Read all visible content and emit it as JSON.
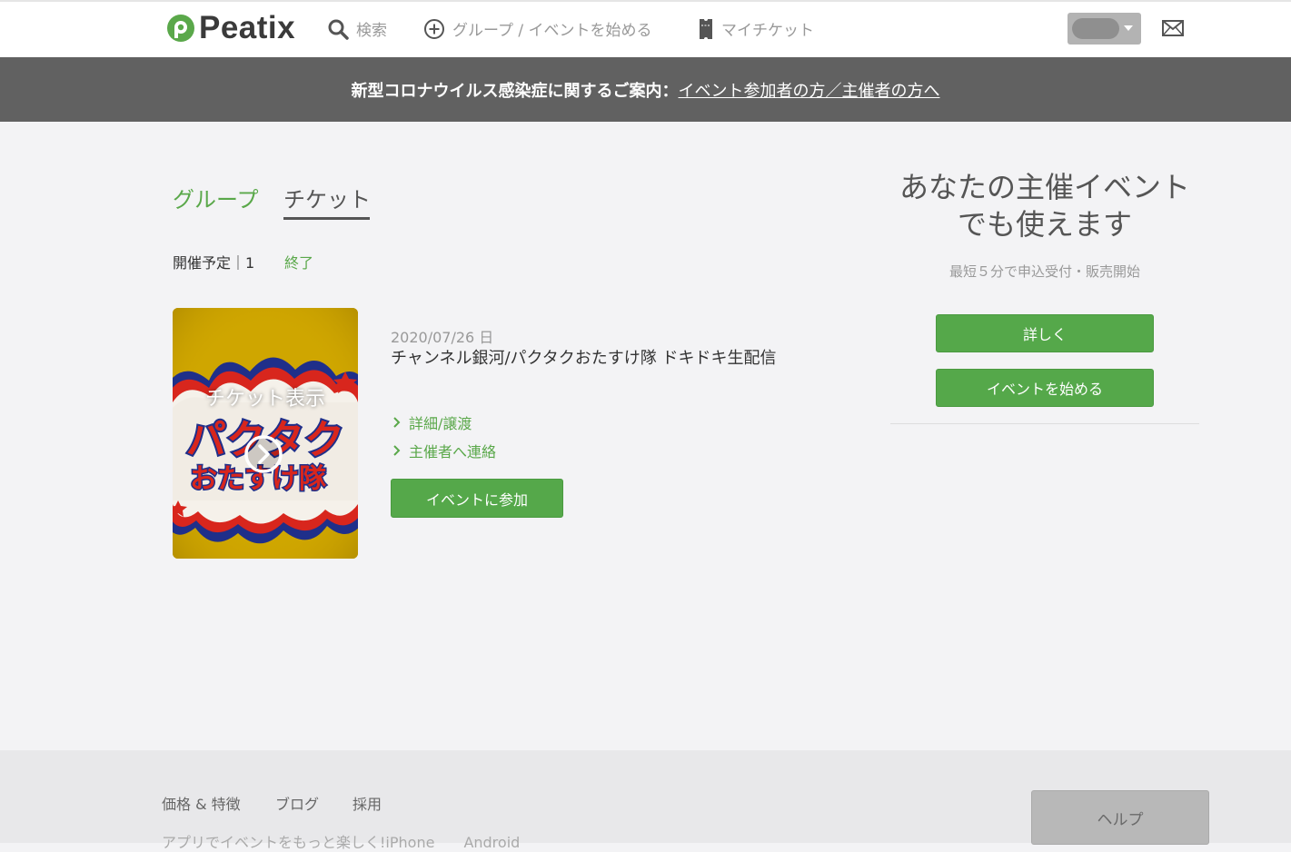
{
  "header": {
    "logo_text": "Peatix",
    "nav": {
      "search_label": "検索",
      "start_label": "グループ / イベントを始める",
      "ticket_label": "マイチケット"
    },
    "icons": {
      "search": "search-icon",
      "start": "plus-circle-icon",
      "ticket": "ticket-icon",
      "mail": "mail-icon",
      "account_caret": "caret-down-icon"
    }
  },
  "notice": {
    "prefix": "新型コロナウイルス感染症に関するご案内：",
    "link": "イベント参加者の方／主催者の方へ"
  },
  "tabs": {
    "group": "グループ",
    "ticket": "チケット"
  },
  "subtabs": {
    "upcoming": "開催予定｜1",
    "ended": "終了"
  },
  "event": {
    "thumbnail_label": "チケット表示",
    "date": "2020/07/26 日",
    "title": "チャンネル銀河/パクタクおたすけ隊 ドキドキ生配信",
    "links": {
      "detail": "詳細/譲渡",
      "contact": "主催者へ連絡"
    },
    "join_button": "イベントに参加",
    "artwork_text_1": "パクタク",
    "artwork_text_2": "おたすけ隊"
  },
  "promo": {
    "title_line1": "あなたの主催イベント",
    "title_line2": "でも使えます",
    "subtitle": "最短５分で申込受付・販売開始",
    "more_button": "詳しく",
    "start_button": "イベントを始める"
  },
  "footer": {
    "links": {
      "price": "価格 & 特徴",
      "blog": "ブログ",
      "recruit": "採用"
    },
    "app_text": "アプリでイベントをもっと楽しく!",
    "iphone": "iPhone",
    "android": "Android",
    "help_button": "ヘルプ"
  },
  "colors": {
    "accent_green": "#55a84a",
    "banner_gray": "#616161",
    "background": "#f3f3f5"
  }
}
